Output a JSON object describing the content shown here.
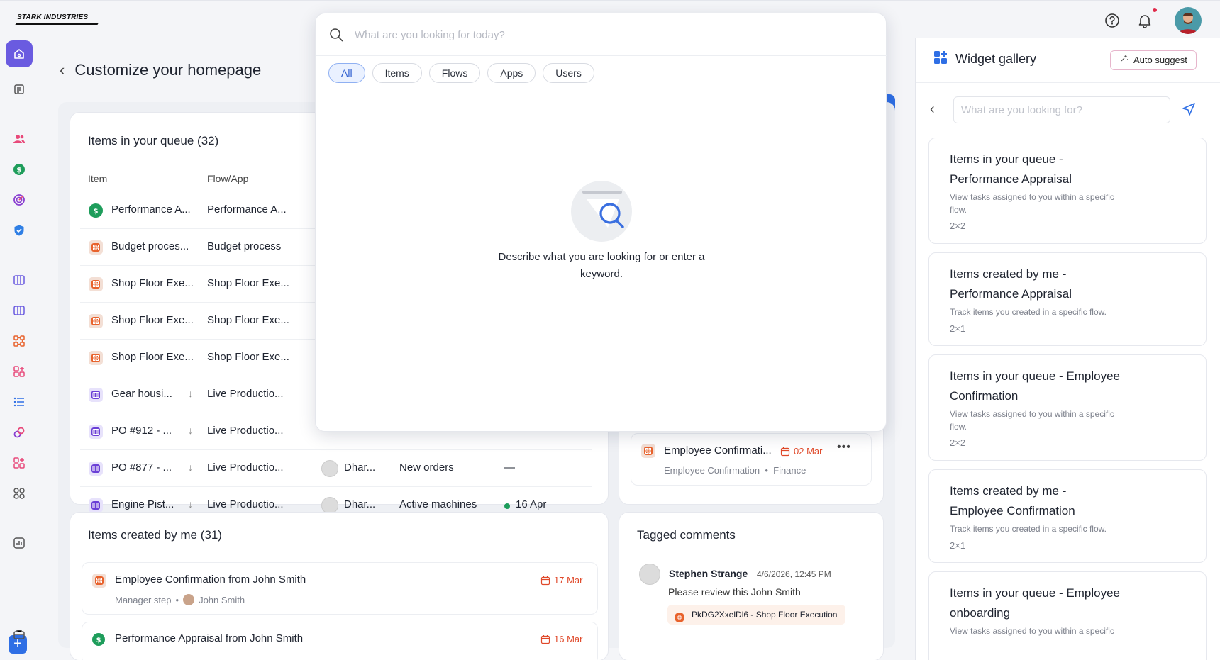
{
  "topbar": {
    "logo_text": "STARK INDUSTRIES",
    "icons": [
      "help-icon",
      "bell-icon",
      "avatar"
    ]
  },
  "rail": {
    "items": [
      "home-icon",
      "notes-icon",
      "users-icon",
      "dollar-icon",
      "target-icon",
      "shield-icon",
      "board-icon",
      "board-icon",
      "flow-icon",
      "apps-add-icon",
      "list-icon",
      "link-icon",
      "apps-add-icon",
      "grid-icon",
      "chart-icon",
      "plus-icon",
      "briefcase-icon"
    ]
  },
  "page": {
    "title": "Customize your homepage"
  },
  "queue": {
    "title": "Items in your queue (32)",
    "col_item": "Item",
    "col_flow": "Flow/App",
    "rows": [
      {
        "item": "Performance A...",
        "flow": "Performance A...",
        "icon": "dollar-icon"
      },
      {
        "item": "Budget proces...",
        "flow": "Budget process",
        "icon": "flow-icon"
      },
      {
        "item": "Shop Floor Exe...",
        "flow": "Shop Floor Exe...",
        "icon": "flow-icon"
      },
      {
        "item": "Shop Floor Exe...",
        "flow": "Shop Floor Exe...",
        "icon": "flow-icon"
      },
      {
        "item": "Shop Floor Exe...",
        "flow": "Shop Floor Exe...",
        "icon": "flow-icon"
      },
      {
        "item": "Gear housi...",
        "flow": "Live Productio...",
        "icon": "board-icon"
      },
      {
        "item": "PO #912 - ...",
        "flow": "Live Productio...",
        "icon": "board-icon"
      },
      {
        "item": "PO #877 - ...",
        "flow": "Live Productio...",
        "icon": "board-icon",
        "user": "Dhar...",
        "stage": "New orders",
        "due": "—"
      },
      {
        "item": "Engine Pist...",
        "flow": "Live Productio...",
        "icon": "board-icon",
        "user": "Dhar...",
        "stage": "Active machines",
        "due": "16 Apr"
      }
    ]
  },
  "side_card": {
    "title": "Employee Confirmati...",
    "date": "02 Mar",
    "sub1": "Employee Confirmation",
    "sub2": "Finance"
  },
  "created": {
    "title": "Items created by me (31)",
    "items": [
      {
        "title": "Employee Confirmation from John Smith",
        "step": "Manager step",
        "user": "John Smith",
        "date": "17 Mar"
      },
      {
        "title": "Performance Appraisal from John Smith",
        "date": "16 Mar"
      }
    ]
  },
  "tagged": {
    "title": "Tagged comments",
    "comment": {
      "author": "Stephen Strange",
      "time": "4/6/2026, 12:45 PM",
      "text": "Please review this John Smith",
      "tag": "PkDG2XxelDl6 - Shop Floor Execution"
    }
  },
  "search_popup": {
    "placeholder": "What are you looking for today?",
    "chips": [
      "All",
      "Items",
      "Flows",
      "Apps",
      "Users"
    ],
    "active_chip": "All",
    "empty_line1": "Describe what you are looking for or enter a",
    "empty_line2": "keyword."
  },
  "widget_gallery": {
    "title": "Widget gallery",
    "auto_suggest": "Auto suggest",
    "search_placeholder": "What are you looking for?",
    "cards": [
      {
        "title_l1": "Items in your queue -",
        "title_l2": "Performance Appraisal",
        "desc_l1": "View tasks assigned to you within a specific",
        "desc_l2": "flow.",
        "size": "2×2"
      },
      {
        "title_l1": "Items created by me -",
        "title_l2": "Performance Appraisal",
        "desc_l1": "Track items you created in a specific flow.",
        "desc_l2": "",
        "size": "2×1"
      },
      {
        "title_l1": "Items in your queue - Employee",
        "title_l2": "Confirmation",
        "desc_l1": "View tasks assigned to you within a specific",
        "desc_l2": "flow.",
        "size": "2×2"
      },
      {
        "title_l1": "Items created by me -",
        "title_l2": "Employee Confirmation",
        "desc_l1": "Track items you created in a specific flow.",
        "desc_l2": "",
        "size": "2×1"
      },
      {
        "title_l1": "Items in your queue - Employee",
        "title_l2": "onboarding",
        "desc_l1": "View tasks assigned to you within a specific",
        "desc_l2": "",
        "size": ""
      }
    ]
  },
  "colors": {
    "accent_purple": "#6a5be0",
    "primary_blue": "#2f6fe5",
    "flow_orange": "#e8622c",
    "success_green": "#1e9d5b",
    "date_red": "#e0492a"
  }
}
